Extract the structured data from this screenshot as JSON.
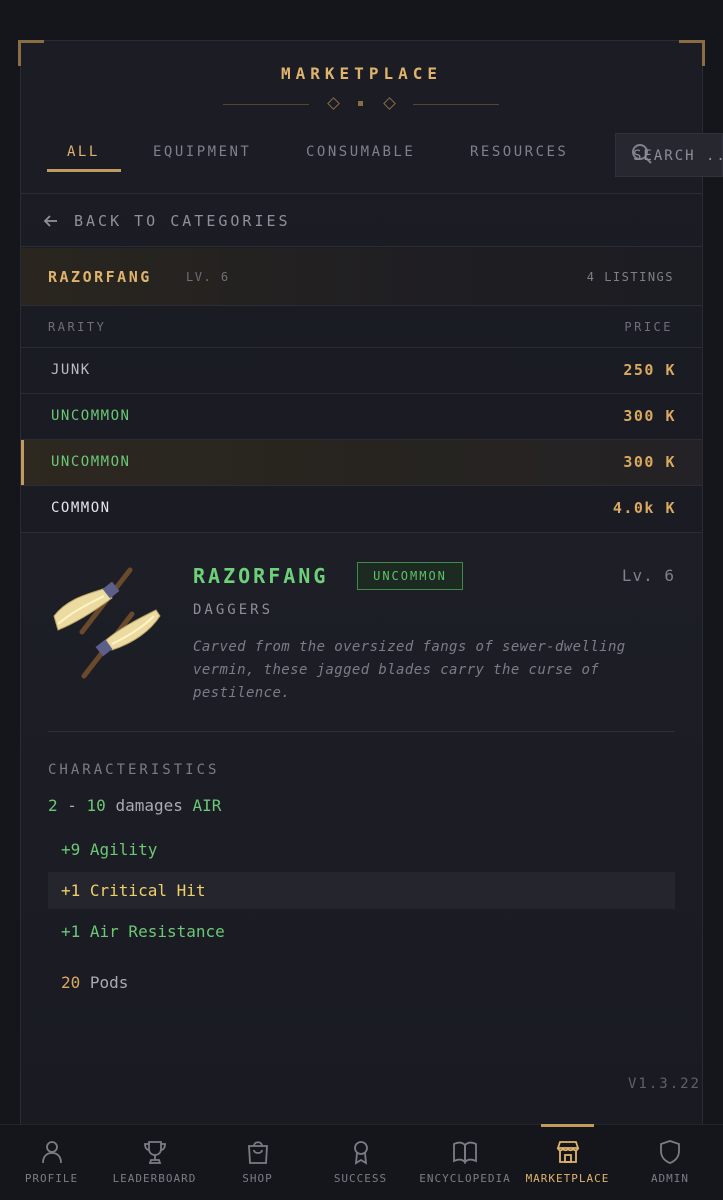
{
  "header": {
    "title": "MARKETPLACE"
  },
  "tabs": [
    {
      "label": "ALL",
      "active": true
    },
    {
      "label": "EQUIPMENT",
      "active": false
    },
    {
      "label": "CONSUMABLE",
      "active": false
    },
    {
      "label": "RESOURCES",
      "active": false
    }
  ],
  "search": {
    "placeholder": "SEARCH ..."
  },
  "back": {
    "label": "BACK TO CATEGORIES"
  },
  "item": {
    "name": "RAZORFANG",
    "level": "LV. 6",
    "listings": "4 LISTINGS"
  },
  "columns": {
    "rarity": "RARITY",
    "price": "PRICE"
  },
  "listings": [
    {
      "rarity": "JUNK",
      "price": "250 K",
      "color": "#b9bac2",
      "selected": false
    },
    {
      "rarity": "UNCOMMON",
      "price": "300 K",
      "color": "#6cc777",
      "selected": false
    },
    {
      "rarity": "UNCOMMON",
      "price": "300 K",
      "color": "#6cc777",
      "selected": true
    },
    {
      "rarity": "COMMON",
      "price": "4.0k K",
      "color": "#e6e6ea",
      "selected": false
    }
  ],
  "detail": {
    "name": "RAZORFANG",
    "rarity": "UNCOMMON",
    "level": "Lv. 6",
    "type": "DAGGERS",
    "description": "Carved from the oversized fangs of sewer-dwelling vermin, these jagged blades carry the curse of pestilence.",
    "characteristics_title": "CHARACTERISTICS",
    "damage": {
      "min": "2",
      "sep": " - ",
      "max": "10",
      "word": " damages ",
      "element": "AIR"
    },
    "stats": [
      {
        "value": "+9 Agility",
        "style": "green"
      },
      {
        "value": "+1 Critical Hit",
        "style": "hl"
      },
      {
        "value": "+1 Air Resistance",
        "style": "green"
      }
    ],
    "pods": {
      "value": "20",
      "label": " Pods"
    }
  },
  "version": "V1.3.22",
  "nav": [
    {
      "label": "PROFILE",
      "icon": "user-icon",
      "active": false
    },
    {
      "label": "LEADERBOARD",
      "icon": "trophy-icon",
      "active": false
    },
    {
      "label": "SHOP",
      "icon": "shopping-bag-icon",
      "active": false
    },
    {
      "label": "SUCCESS",
      "icon": "award-icon",
      "active": false
    },
    {
      "label": "ENCYCLOPEDIA",
      "icon": "book-icon",
      "active": false
    },
    {
      "label": "MARKETPLACE",
      "icon": "store-icon",
      "active": true
    },
    {
      "label": "ADMIN",
      "icon": "shield-icon",
      "active": false
    }
  ],
  "colors": {
    "accent": "#e0b36c",
    "green": "#6cc777",
    "background": "#15161c"
  }
}
